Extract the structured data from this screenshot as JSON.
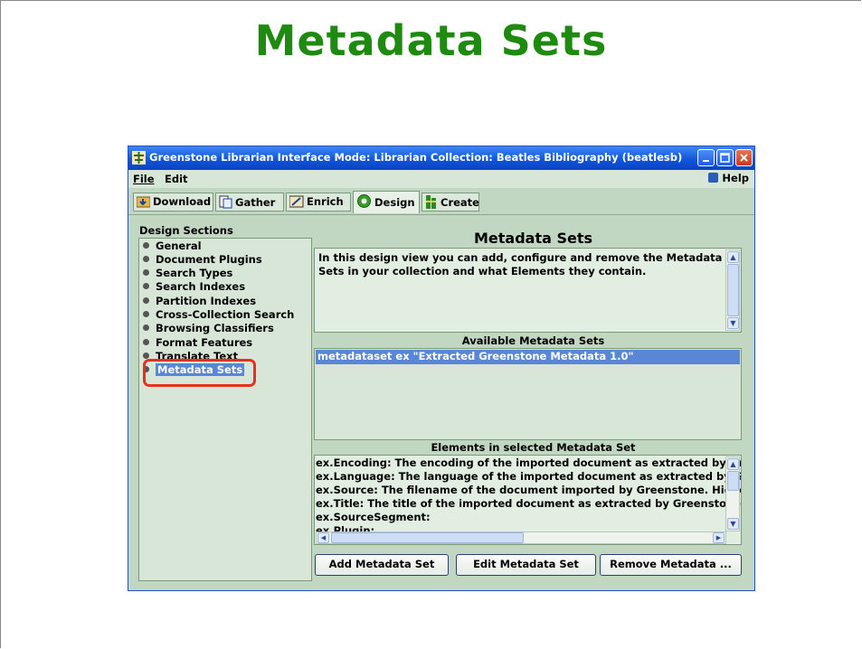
{
  "slide": {
    "title": "Metadata Sets",
    "title_color": "#1f8a10",
    "callout_color": "#e4321e"
  },
  "window": {
    "title": "Greenstone Librarian Interface  Mode: Librarian  Collection: Beatles Bibliography (beatlesb)",
    "controls": [
      "minimize-icon",
      "maximize-icon",
      "close-icon"
    ]
  },
  "menu": {
    "file": "File",
    "edit": "Edit",
    "help": "Help"
  },
  "tabs": [
    {
      "label": "Download",
      "icon": "download-icon"
    },
    {
      "label": "Gather",
      "icon": "gather-icon"
    },
    {
      "label": "Enrich",
      "icon": "enrich-icon"
    },
    {
      "label": "Design",
      "icon": "design-gear-icon",
      "active": true
    },
    {
      "label": "Create",
      "icon": "create-icon"
    }
  ],
  "design_sections": {
    "heading": "Design Sections",
    "items": [
      "General",
      "Document Plugins",
      "Search Types",
      "Search Indexes",
      "Partition Indexes",
      "Cross-Collection Search",
      "Browsing Classifiers",
      "Format Features",
      "Translate Text",
      "Metadata Sets"
    ],
    "selected": "Metadata Sets"
  },
  "panel": {
    "title": "Metadata Sets",
    "description": "In this design view you can add, configure and remove the Metadata Sets in your collection and what Elements they contain.",
    "available_heading": "Available Metadata Sets",
    "available_sets": [
      "metadataset ex \"Extracted Greenstone Metadata 1.0\""
    ],
    "elements_heading": "Elements in selected Metadata Set",
    "elements": [
      "ex.Encoding: The encoding of the imported document as extracted by Gree",
      "ex.Language: The language of the imported document as extracted by Gre",
      "ex.Source: The filename of the document imported by Greenstone. Hidden",
      "ex.Title: The title of the imported document as extracted by Greenstone. N",
      "ex.SourceSegment:",
      "ex.Plugin:"
    ]
  },
  "buttons": {
    "add": "Add Metadata Set",
    "edit": "Edit Metadata Set",
    "remove": "Remove Metadata ..."
  }
}
